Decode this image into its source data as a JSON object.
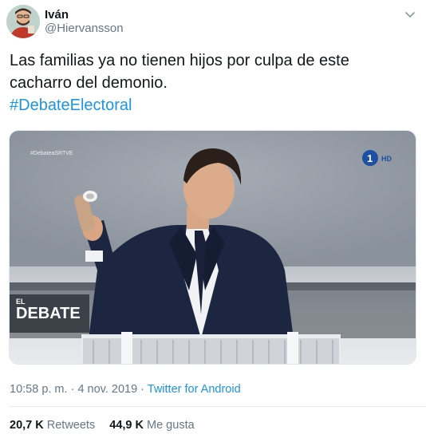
{
  "author": {
    "display_name": "Iván",
    "handle": "@Hiervansson"
  },
  "tweet": {
    "text_line1": "Las familias ya no tienen hijos por culpa de este",
    "text_line2": "cacharro del demonio.",
    "hashtag": "#DebateElectoral"
  },
  "media": {
    "watermark": "#DebateaSRTVE",
    "channel_number": "1",
    "channel_hd": "HD",
    "overlay_el": "EL",
    "overlay_debate": "DEBATE"
  },
  "meta": {
    "time": "10:58 p. m.",
    "separator1": " · ",
    "date": "4 nov. 2019",
    "separator2": " · ",
    "source": "Twitter for Android"
  },
  "stats": {
    "retweets_count": "20,7 K",
    "retweets_label": "Retweets",
    "likes_count": "44,9 K",
    "likes_label": "Me gusta"
  },
  "icons": {
    "more": "chevron-down-icon"
  },
  "colors": {
    "link": "#1b95e0",
    "secondary_text": "#657786",
    "primary_text": "#14171a",
    "suit": "#1c2640",
    "backdrop": "#8f97a2"
  }
}
